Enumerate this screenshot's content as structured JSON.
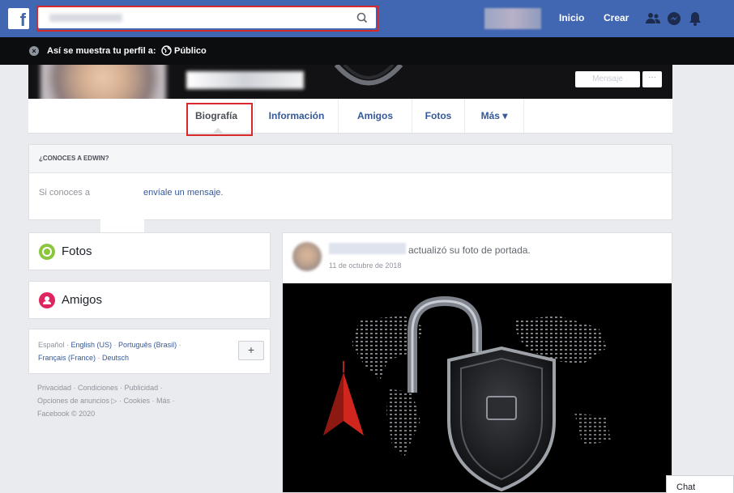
{
  "topbar": {
    "logo": "f",
    "search": {
      "placeholder": "",
      "value": ""
    },
    "nav": {
      "home": "Inicio",
      "create": "Crear"
    },
    "icons": [
      "friends-icon",
      "messenger-icon",
      "notifications-icon"
    ]
  },
  "privacy_bar": {
    "text": "Así se muestra tu perfil a:",
    "audience": "Público"
  },
  "cover": {
    "message_button": "Mensaje",
    "more_button": "···"
  },
  "tabs": [
    {
      "label": "Biografía",
      "active": true
    },
    {
      "label": "Información",
      "active": false
    },
    {
      "label": "Amigos",
      "active": false
    },
    {
      "label": "Fotos",
      "active": false
    },
    {
      "label": "Más ▾",
      "active": false
    }
  ],
  "know_card": {
    "title": "¿CONOCES A EDWIN?",
    "text": "Si conoces a",
    "link": "envíale un mensaje."
  },
  "sidebar": {
    "photos_label": "Fotos",
    "friends_label": "Amigos",
    "languages": {
      "current": "Español",
      "line1_links": [
        "English (US)",
        "Português (Brasil)"
      ],
      "line2_links": [
        "Français (France)",
        "Deutsch"
      ],
      "add": "+"
    },
    "footer": {
      "line1": "Privacidad · Condiciones · Publicidad ·",
      "line2": "Opciones de anuncios ▷ · Cookies · Más ·",
      "line3": "Facebook © 2020"
    }
  },
  "post": {
    "action": "actualizó su foto de portada.",
    "date": "11 de octubre de 2018"
  },
  "chat": {
    "label": "Chat"
  },
  "colors": {
    "brand": "#4267b2",
    "link": "#365899",
    "highlight": "#d8282a",
    "privacy_bar": "#0c0d0f"
  }
}
